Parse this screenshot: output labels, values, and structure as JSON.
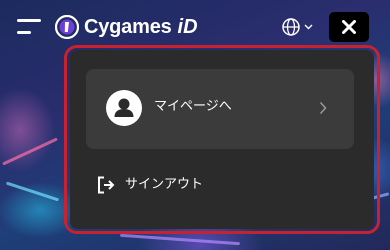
{
  "header": {
    "logo_text": "Cygames",
    "logo_suffix": "iD",
    "icons": {
      "menu": "hamburger-menu-icon",
      "language": "globe-icon",
      "close": "close-icon"
    }
  },
  "menu": {
    "mypage_label": "マイページへ",
    "signout_label": "サインアウト",
    "icons": {
      "avatar": "user-icon",
      "chevron": "chevron-right-icon",
      "signout": "sign-out-icon"
    }
  },
  "colors": {
    "panel_bg": "#2b2b2b",
    "card_bg": "#3b3b3b",
    "highlight_outline": "#c8222f",
    "close_button_bg": "#000000"
  }
}
